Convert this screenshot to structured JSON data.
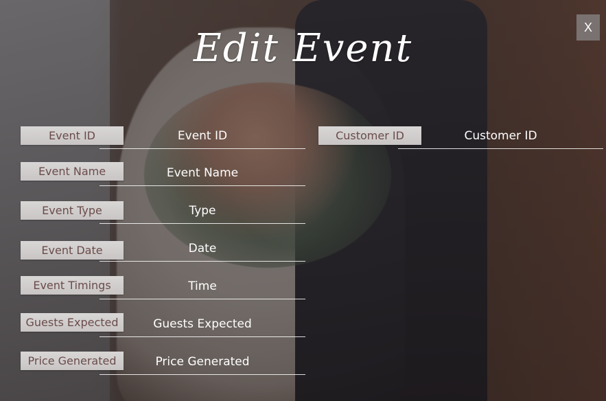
{
  "window": {
    "title": "Edit Event",
    "close_label": "X"
  },
  "form": {
    "event_id": {
      "label": "Event ID",
      "placeholder": "Event ID"
    },
    "customer_id": {
      "label": "Customer ID",
      "placeholder": "Customer ID"
    },
    "event_name": {
      "label": "Event Name",
      "placeholder": "Event Name"
    },
    "event_type": {
      "label": "Event Type",
      "placeholder": "Type"
    },
    "event_date": {
      "label": "Event Date",
      "placeholder": "Date"
    },
    "event_timings": {
      "label": "Event Timings",
      "placeholder": "Time"
    },
    "guests_expected": {
      "label": "Guests Expected",
      "placeholder": "Guests Expected"
    },
    "price_generated": {
      "label": "Price Generated",
      "placeholder": "Price Generated"
    }
  },
  "colors": {
    "label_bg": "#d4d1d1",
    "label_text": "#6a4c4a",
    "field_text": "#ffffff",
    "close_bg": "#7a7270"
  }
}
